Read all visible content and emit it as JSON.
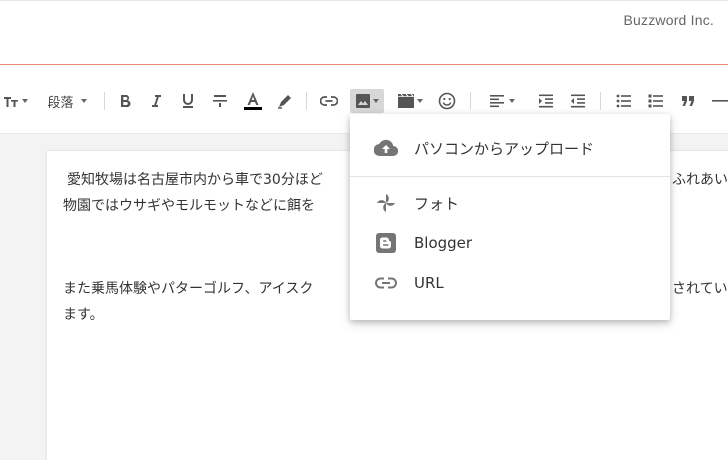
{
  "header": {
    "brand": "Buzzword Inc."
  },
  "toolbar": {
    "paragraph_label": "段落",
    "text_color_underline": "#000000"
  },
  "document": {
    "paragraph1_line1": "愛知牧場は名古屋市内から車で30分ほど",
    "paragraph1_line1_tail": "ふれあい",
    "paragraph1_line2": "物園ではウサギやモルモットなどに餌を",
    "paragraph2_line1": "また乗馬体験やパターゴルフ、アイスク",
    "paragraph2_line1_tail": "されてい",
    "paragraph2_line2": "ます。"
  },
  "image_menu": {
    "items": [
      {
        "label": "パソコンからアップロード",
        "icon": "cloud-upload-icon"
      },
      {
        "label": "フォト",
        "icon": "google-photos-icon"
      },
      {
        "label": "Blogger",
        "icon": "blogger-icon"
      },
      {
        "label": "URL",
        "icon": "link-icon"
      }
    ]
  },
  "colors": {
    "accent_line": "#e58a76",
    "icon_gray": "#757575"
  }
}
